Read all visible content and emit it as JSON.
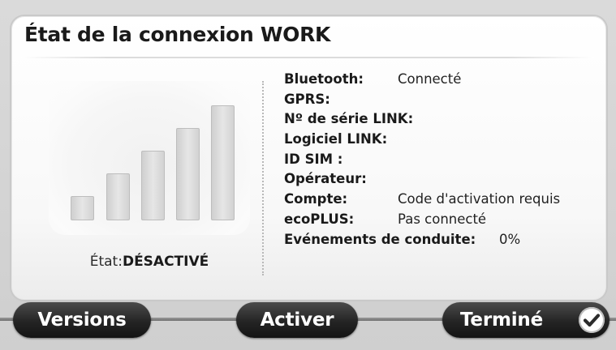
{
  "window": {
    "title": "État de la connexion WORK"
  },
  "status": {
    "label": "État:",
    "value": "DÉSACTIVÉ",
    "signal_bars_total": 5
  },
  "info": {
    "rows": [
      {
        "label": "Bluetooth:",
        "value": "Connecté"
      },
      {
        "label": "GPRS:",
        "value": ""
      },
      {
        "label": "Nº de série LINK:",
        "value": ""
      },
      {
        "label": "Logiciel LINK:",
        "value": ""
      },
      {
        "label": "ID SIM :",
        "value": ""
      },
      {
        "label": "Opérateur:",
        "value": ""
      },
      {
        "label": "Compte:",
        "value": "Code d'activation requis"
      },
      {
        "label": "ecoPLUS:",
        "value": "Pas connecté"
      },
      {
        "label": "Evénements de conduite:",
        "value": "0%"
      }
    ]
  },
  "buttons": {
    "versions": "Versions",
    "activate": "Activer",
    "done": "Terminé"
  },
  "icons": {
    "done": "check-circle-icon",
    "signal": "signal-strength-icon"
  },
  "colors": {
    "button_bg": "#242424",
    "button_text": "#ffffff",
    "panel_bg": "#ffffff",
    "bezel": "#d4d4d4"
  }
}
